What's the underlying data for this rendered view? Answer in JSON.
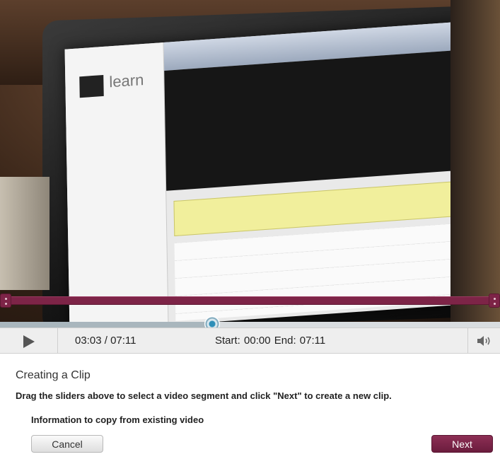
{
  "player": {
    "current_time": "03:03",
    "duration": "07:11",
    "time_separator": " / ",
    "progress_fraction": 0.4246,
    "start_label": "Start:",
    "start_value": "00:00",
    "end_label": "End:",
    "end_value": "07:11",
    "icons": {
      "play": "play-icon",
      "volume": "volume-icon",
      "playhead": "playhead-icon"
    },
    "colors": {
      "clip_range": "#7d2447",
      "playhead": "#2e8fb8"
    }
  },
  "video": {
    "screen_logo": "learn"
  },
  "form": {
    "title": "Creating a Clip",
    "instructions": "Drag the sliders above to select a video segment and click \"Next\" to create a new clip.",
    "subtitle": "Information to copy from existing video",
    "cancel_label": "Cancel",
    "next_label": "Next",
    "colors": {
      "next_button": "#7d2447"
    }
  }
}
